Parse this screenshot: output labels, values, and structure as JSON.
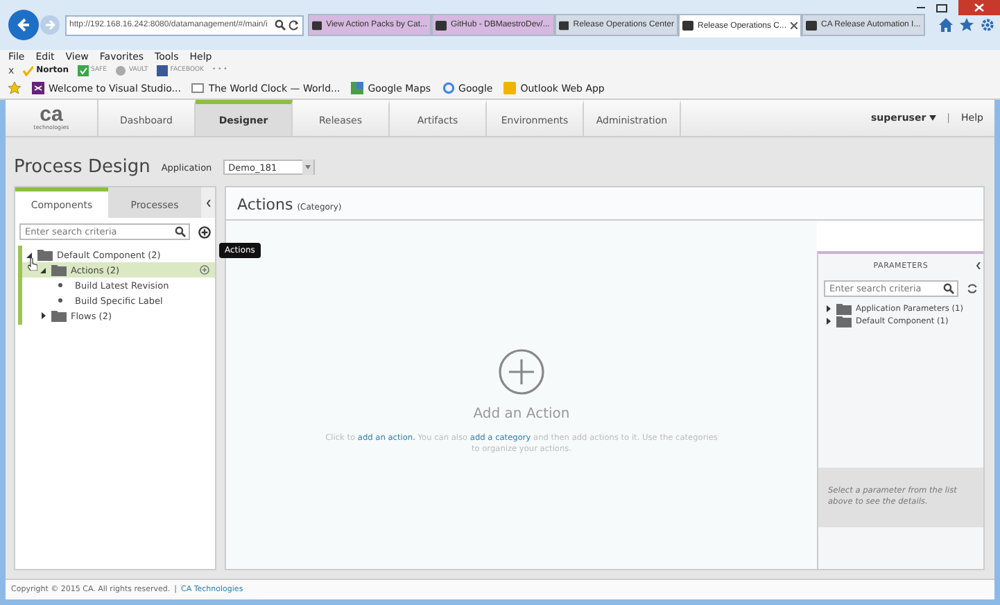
{
  "browser": {
    "address": "http://192.168.16.242:8080/datamanagement/#/main/i",
    "tabs": [
      {
        "label": "View Action Packs by Cat...",
        "selected": false,
        "color": "#d6b8e0"
      },
      {
        "label": "GitHub - DBMaestroDev/...",
        "selected": false,
        "color": "#d6b8e0"
      },
      {
        "label": "Release Operations Center",
        "selected": false,
        "color": "#d3dce6"
      },
      {
        "label": "Release Operations C...",
        "selected": true,
        "color": "#ffffff"
      },
      {
        "label": "CA Release Automation I...",
        "selected": false,
        "color": "#d3dce6"
      }
    ],
    "menu": [
      "File",
      "Edit",
      "View",
      "Favorites",
      "Tools",
      "Help"
    ],
    "close_toolbar": "x",
    "toolbar": [
      {
        "label": "Norton",
        "kind": "norton"
      },
      {
        "label": "SAFE",
        "kind": "safe"
      },
      {
        "label": "VAULT",
        "kind": "vault"
      },
      {
        "label": "FACEBOOK",
        "kind": "facebook"
      },
      {
        "label": "• • •",
        "kind": "more"
      }
    ],
    "favorites": [
      {
        "label": "Welcome to Visual Studio...",
        "kind": "vs"
      },
      {
        "label": "The World Clock — World...",
        "kind": "page"
      },
      {
        "label": "Google Maps",
        "kind": "maps"
      },
      {
        "label": "Google",
        "kind": "google"
      },
      {
        "label": "Outlook Web App",
        "kind": "outlook"
      }
    ]
  },
  "header": {
    "logo": "ca",
    "logo_sub": "technologies",
    "nav": [
      {
        "label": "Dashboard",
        "selected": false
      },
      {
        "label": "Designer",
        "selected": true
      },
      {
        "label": "Releases",
        "selected": false
      },
      {
        "label": "Artifacts",
        "selected": false
      },
      {
        "label": "Environments",
        "selected": false
      },
      {
        "label": "Administration",
        "selected": false
      }
    ],
    "user": "superuser",
    "separator": "|",
    "help": "Help"
  },
  "page": {
    "title": "Process Design",
    "application_label": "Application",
    "application": "Demo_181"
  },
  "left_panel": {
    "tabs": [
      {
        "label": "Components",
        "selected": true
      },
      {
        "label": "Processes",
        "selected": false
      }
    ],
    "search": {
      "placeholder": "Enter search criteria"
    },
    "tree": [
      {
        "label": "Default Component (2)",
        "kind": "folder",
        "expanded": true,
        "selected": false,
        "children": [
          {
            "label": "Actions (2)",
            "kind": "folder",
            "expanded": true,
            "selected": true,
            "children": [
              {
                "label": "Build Latest Revision",
                "kind": "action",
                "selected": false
              },
              {
                "label": "Build Specific Label",
                "kind": "action",
                "selected": false
              }
            ]
          },
          {
            "label": "Flows (2)",
            "kind": "folder",
            "expanded": false,
            "selected": false
          }
        ]
      }
    ],
    "tooltip": "Actions"
  },
  "center": {
    "title": "Actions",
    "subtitle": "(Category)",
    "empty_title": "Add an Action",
    "message": [
      {
        "text": "Click to ",
        "kind": "text"
      },
      {
        "text": "add an action.",
        "kind": "link"
      },
      {
        "text": " You can also ",
        "kind": "text"
      },
      {
        "text": "add a category",
        "kind": "link"
      },
      {
        "text": " and then add actions to it. Use the categories to organize your actions.",
        "kind": "text"
      }
    ]
  },
  "parameters": {
    "title": "PARAMETERS",
    "search": {
      "placeholder": "Enter search criteria"
    },
    "tree": [
      {
        "label": "Application Parameters (1)",
        "expanded": false
      },
      {
        "label": "Default Component (1)",
        "expanded": false
      }
    ],
    "hint": "Select a parameter from the list above to see the details."
  },
  "footer": {
    "text": "Copyright © 2015 CA. All rights reserved.",
    "separator": "|",
    "link": "CA Technologies"
  }
}
